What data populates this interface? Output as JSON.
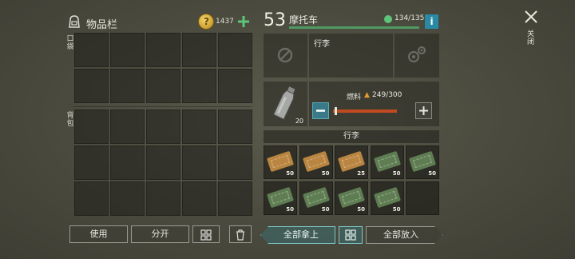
{
  "inventory": {
    "title": "物品栏",
    "coins": "1437",
    "pocket_label": "口袋",
    "backpack_label": "背包",
    "buttons": {
      "use": "使用",
      "split": "分开"
    }
  },
  "vehicle": {
    "level": "53",
    "name": "摩托车",
    "durability": "134/135",
    "info_label": "i",
    "trunk_label": "行李",
    "fuel_label": "燃料",
    "fuel_value": "249/300",
    "fuel_fraction": 0.83,
    "bottle_count": "20",
    "cargo_label": "行李"
  },
  "close_label": "关闭",
  "cargo_items": [
    {
      "color": "orange",
      "count": "50"
    },
    {
      "color": "orange",
      "count": "50"
    },
    {
      "color": "orange",
      "count": "25"
    },
    {
      "color": "green",
      "count": "50"
    },
    {
      "color": "green",
      "count": "50"
    },
    {
      "color": "green",
      "count": "50"
    },
    {
      "color": "green",
      "count": "50"
    },
    {
      "color": "green",
      "count": "50"
    },
    {
      "color": "green",
      "count": "50"
    },
    {
      "color": "empty",
      "count": ""
    }
  ],
  "bottom": {
    "take_all": "全部拿上",
    "put_all": "全部放入"
  },
  "colors": {
    "accent_green": "#4f9a62",
    "info_blue": "#2a8aa6",
    "fuel_bar": "#c24a20",
    "ticket_orange": "#b98540",
    "ticket_green": "#5f7d52"
  }
}
